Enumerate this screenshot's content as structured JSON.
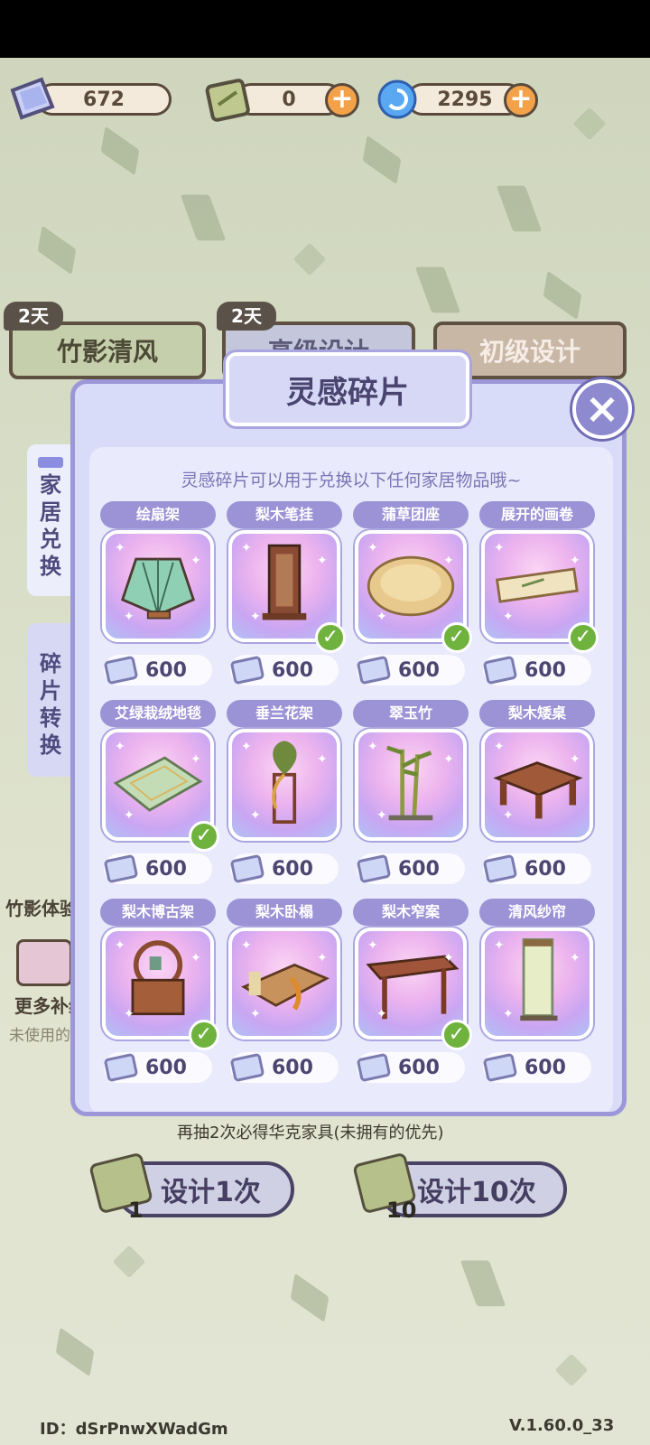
{
  "currencies": {
    "fragments": "672",
    "tickets": "0",
    "gems": "2295",
    "add_label": "+"
  },
  "banners": [
    {
      "label": "竹影清风",
      "days": "2天"
    },
    {
      "label": "高级设计",
      "days": "2天"
    },
    {
      "label": "初级设计"
    }
  ],
  "side_tabs": [
    {
      "label": "家居兑换"
    },
    {
      "label": "碎片转换"
    }
  ],
  "lower": {
    "event_label": "竹影体验",
    "more_label": "更多补给",
    "unused_label": "未使用的",
    "pity_hint": "再抽2次必得华克家具(未拥有的优先)",
    "design_once": "设计1次",
    "design_once_count": "1",
    "design_ten": "设计10次",
    "design_ten_count": "10"
  },
  "popup": {
    "title": "灵感碎片",
    "close_icon": "×",
    "intro": "灵感碎片可以用于兑换以下任何家居物品哦~",
    "owned_mark": "✓",
    "items": [
      {
        "name": "绘扇架",
        "price": "600",
        "owned": false,
        "art": "fan"
      },
      {
        "name": "梨木笔挂",
        "price": "600",
        "owned": true,
        "art": "brushrack"
      },
      {
        "name": "蒲草团座",
        "price": "600",
        "owned": true,
        "art": "cushion"
      },
      {
        "name": "展开的画卷",
        "price": "600",
        "owned": true,
        "art": "scroll"
      },
      {
        "name": "艾绿栽绒地毯",
        "price": "600",
        "owned": true,
        "art": "rug"
      },
      {
        "name": "垂兰花架",
        "price": "600",
        "owned": false,
        "art": "plantstand"
      },
      {
        "name": "翠玉竹",
        "price": "600",
        "owned": false,
        "art": "bamboo"
      },
      {
        "name": "梨木矮桌",
        "price": "600",
        "owned": false,
        "art": "lowtable"
      },
      {
        "name": "梨木博古架",
        "price": "600",
        "owned": true,
        "art": "shelf"
      },
      {
        "name": "梨木卧榻",
        "price": "600",
        "owned": false,
        "art": "daybed"
      },
      {
        "name": "梨木窄案",
        "price": "600",
        "owned": true,
        "art": "narrowtable"
      },
      {
        "name": "清风纱帘",
        "price": "600",
        "owned": false,
        "art": "curtain"
      }
    ]
  },
  "footer": {
    "id_text": "ID：dSrPnwXWadGm",
    "version": "V.1.60.0_33"
  }
}
